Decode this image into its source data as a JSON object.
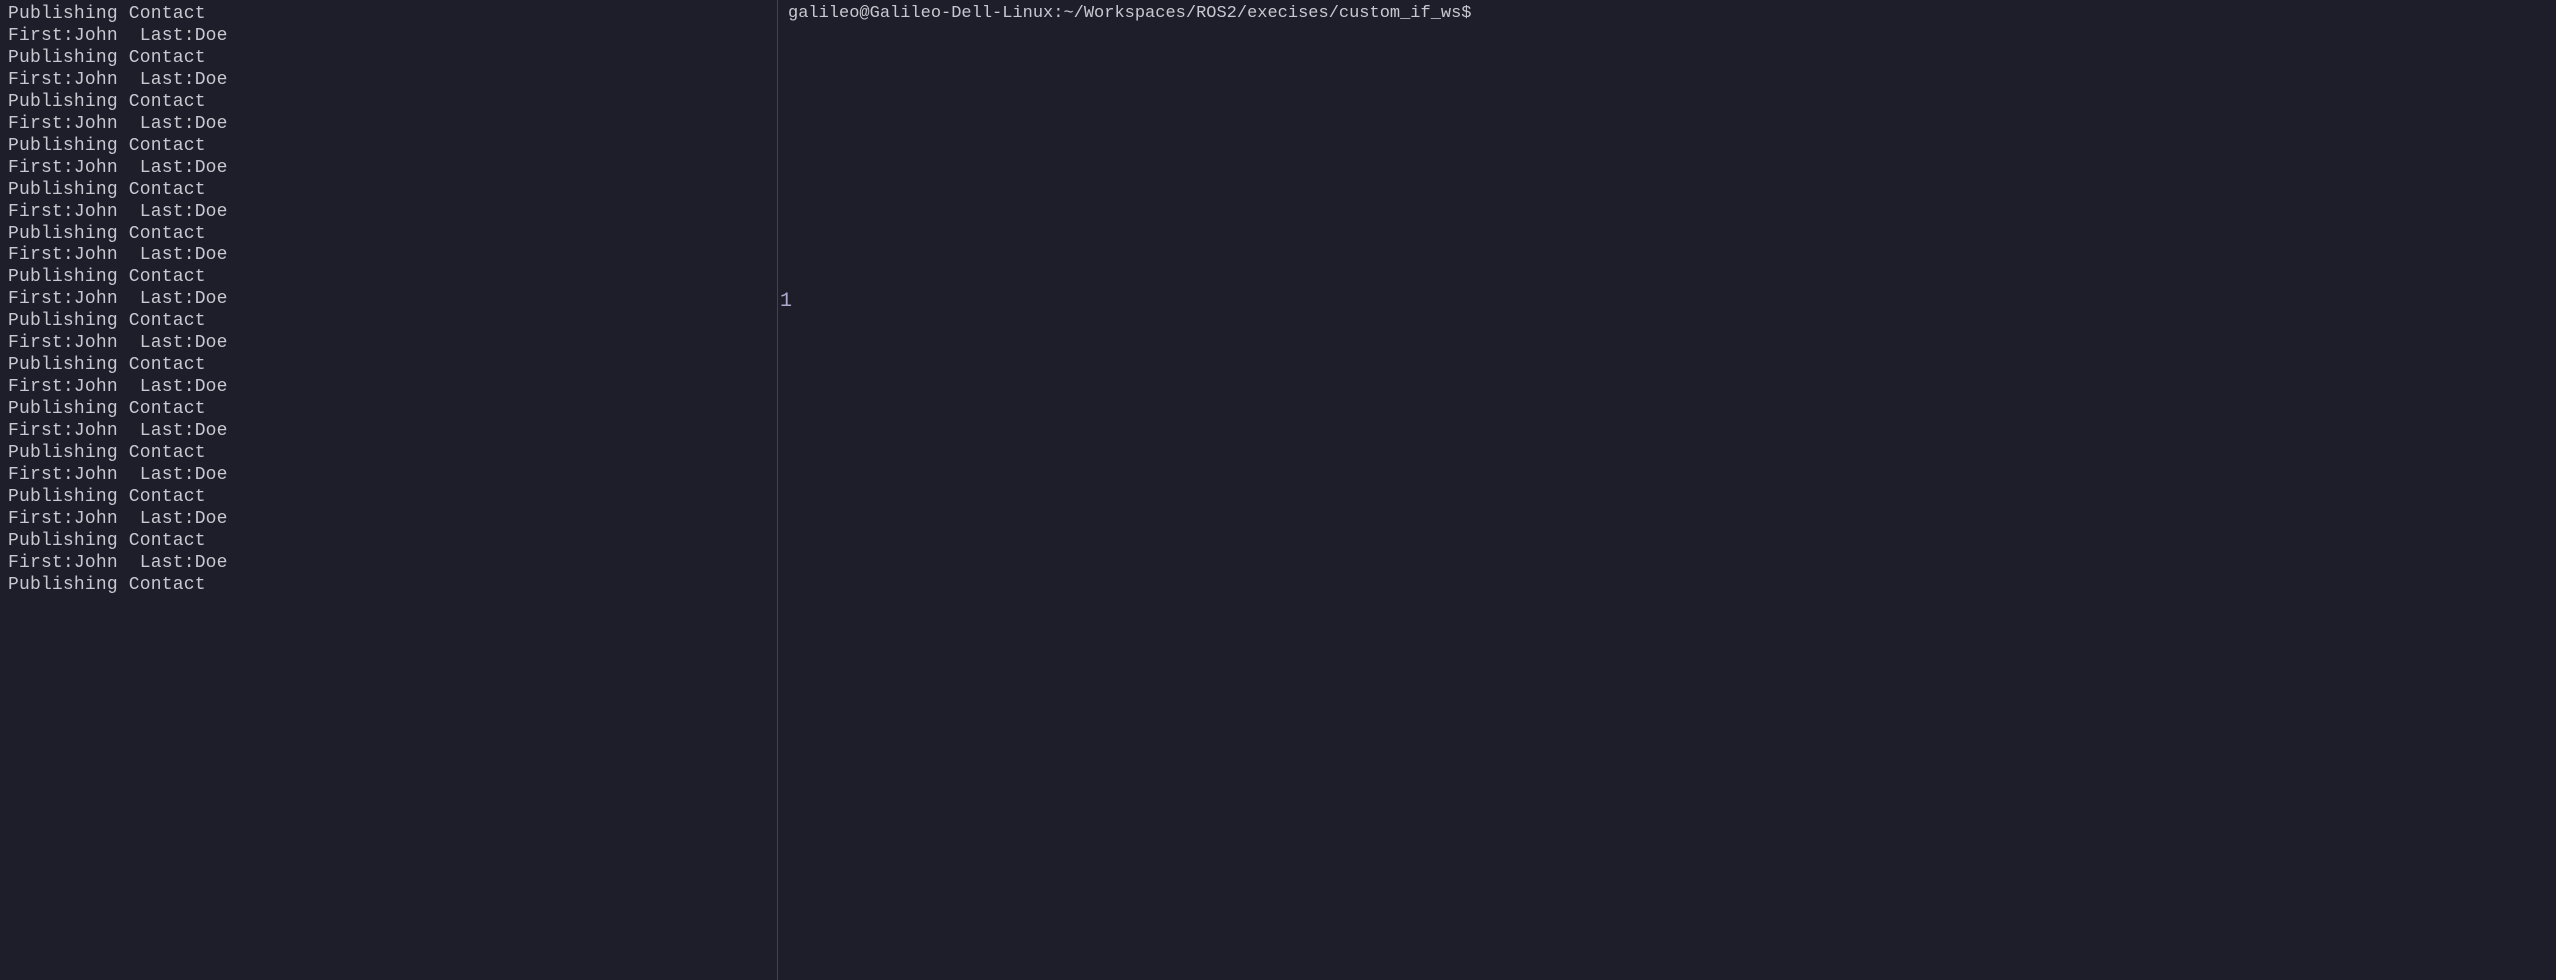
{
  "left_panel": {
    "lines": [
      "Publishing Contact",
      "First:John  Last:Doe",
      "Publishing Contact",
      "First:John  Last:Doe",
      "Publishing Contact",
      "First:John  Last:Doe",
      "Publishing Contact",
      "First:John  Last:Doe",
      "Publishing Contact",
      "First:John  Last:Doe",
      "Publishing Contact",
      "First:John  Last:Doe",
      "Publishing Contact",
      "First:John  Last:Doe",
      "Publishing Contact",
      "First:John  Last:Doe",
      "Publishing Contact",
      "First:John  Last:Doe",
      "Publishing Contact",
      "First:John  Last:Doe",
      "Publishing Contact",
      "First:John  Last:Doe",
      "Publishing Contact",
      "First:John  Last:Doe",
      "Publishing Contact",
      "First:John  Last:Doe",
      "Publishing Contact"
    ]
  },
  "right_panel": {
    "title": "galileo@Galileo-Dell-Linux:~/Workspaces/ROS2/execises/custom_if_ws$",
    "scroll_indicator": "1",
    "lines": []
  }
}
